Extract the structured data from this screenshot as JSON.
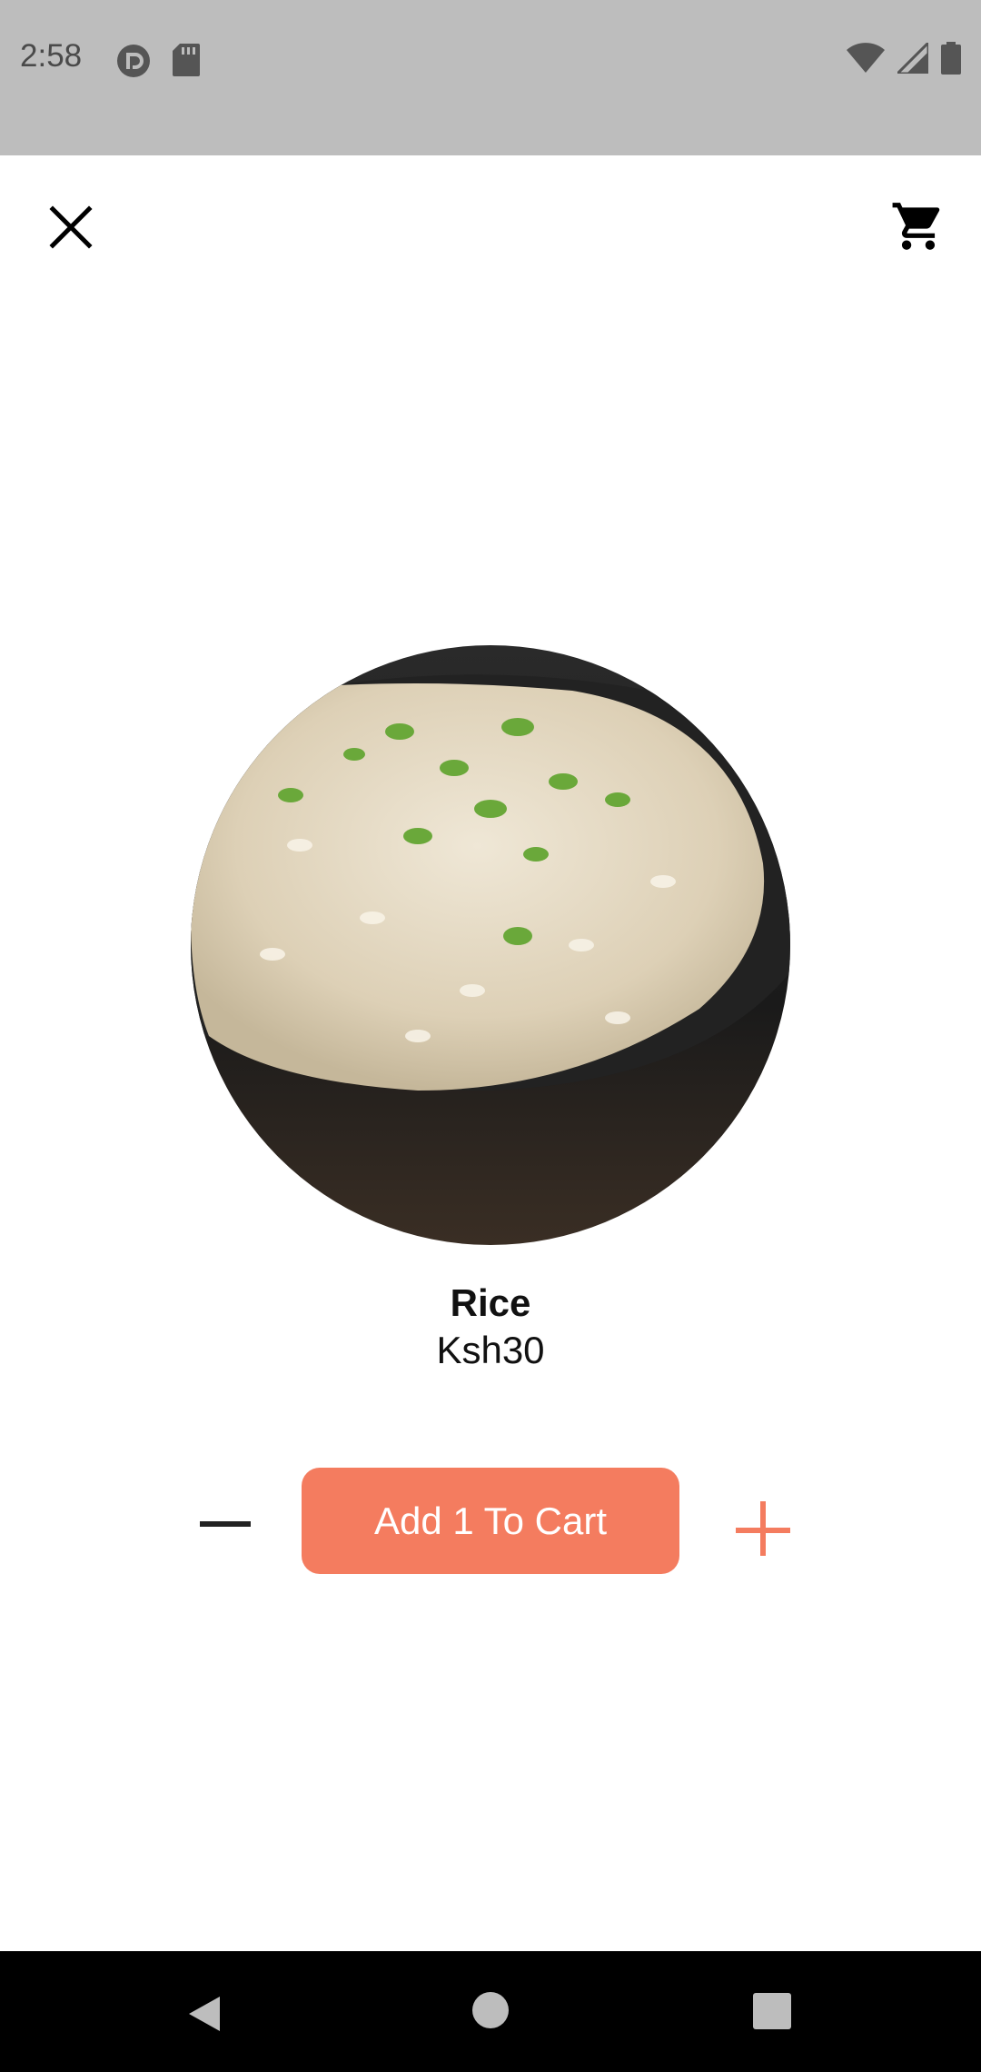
{
  "status_bar": {
    "time": "2:58",
    "left_icons": [
      "pocket-casts-icon",
      "sd-card-icon"
    ],
    "right_icons": [
      "wifi-icon",
      "signal-icon",
      "battery-icon"
    ]
  },
  "app_bar": {
    "close_icon": "close-icon",
    "cart_icon": "cart-icon"
  },
  "product": {
    "name": "Rice",
    "price": "Ksh30",
    "image": "rice-bowl-image"
  },
  "quantity_controls": {
    "minus_icon": "minus-icon",
    "add_button_label": "Add 1 To Cart",
    "plus_icon": "plus-icon"
  },
  "colors": {
    "accent": "#F47C5F",
    "status_bar_bg": "#BDBDBD",
    "nav_bar_bg": "#000000"
  },
  "nav_bar": {
    "buttons": [
      "back-icon",
      "home-icon",
      "recents-icon"
    ]
  }
}
